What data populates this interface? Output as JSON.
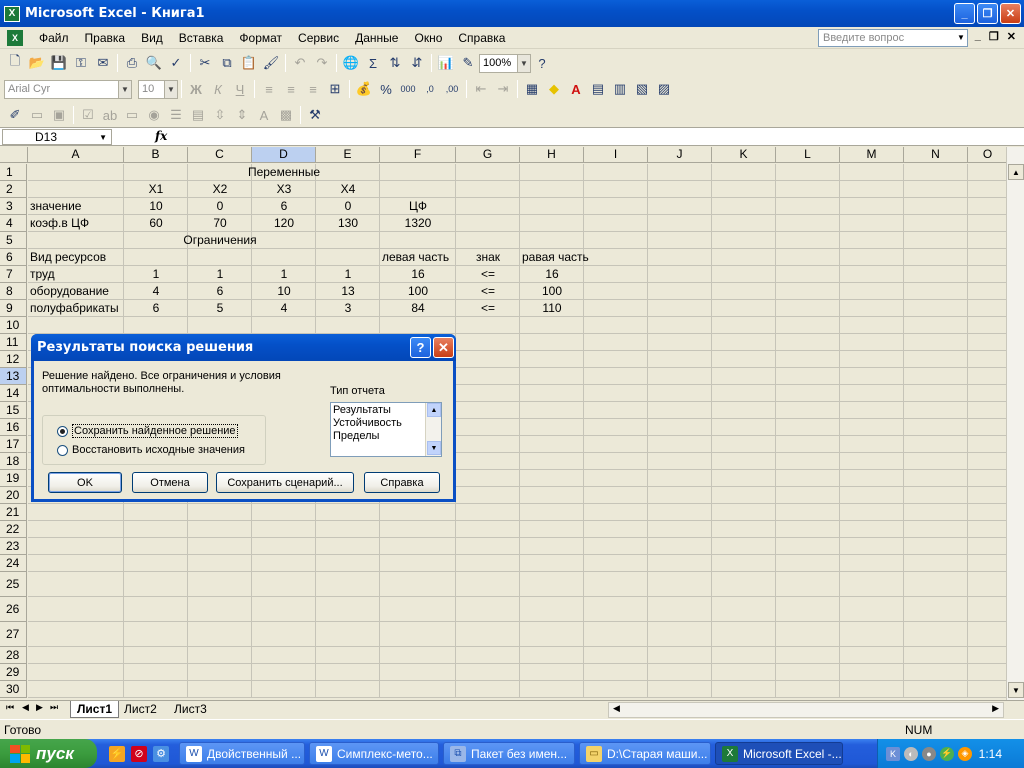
{
  "window": {
    "title": "Microsoft Excel - Книга1"
  },
  "menu": {
    "items": [
      "Файл",
      "Правка",
      "Вид",
      "Вставка",
      "Формат",
      "Сервис",
      "Данные",
      "Окно",
      "Справка"
    ],
    "ask_placeholder": "Введите вопрос"
  },
  "toolbar": {
    "zoom": "100%",
    "font_name": "Arial Cyr",
    "font_size": "10"
  },
  "formula": {
    "name_box": "D13",
    "fx": "fx",
    "content": ""
  },
  "grid": {
    "columns": [
      "A",
      "B",
      "C",
      "D",
      "E",
      "F",
      "G",
      "H",
      "I",
      "J",
      "K",
      "L",
      "M",
      "N",
      "O"
    ],
    "selected_column": "D",
    "rows": [
      "1",
      "2",
      "3",
      "4",
      "5",
      "6",
      "7",
      "8",
      "9",
      "10",
      "11",
      "12",
      "13",
      "14",
      "15",
      "16",
      "17",
      "18",
      "19",
      "20",
      "21",
      "22",
      "23",
      "24",
      "25",
      "26",
      "27",
      "28",
      "29",
      "30"
    ],
    "selected_row": "13",
    "r1": {
      "c": "Переменные"
    },
    "r2": {
      "b": "X1",
      "c": "X2",
      "d": "X3",
      "e": "X4"
    },
    "r3": {
      "a": "значение",
      "b": "10",
      "c": "0",
      "d": "6",
      "e": "0",
      "f": "ЦФ"
    },
    "r4": {
      "a": "коэф.в ЦФ",
      "b": "60",
      "c": "70",
      "d": "120",
      "e": "130",
      "f": "1320"
    },
    "r5": {
      "b": "Ограничения"
    },
    "r6": {
      "a": "Вид ресурсов",
      "f": "левая часть",
      "g": "знак",
      "h": "равая часть"
    },
    "r7": {
      "a": "труд",
      "b": "1",
      "c": "1",
      "d": "1",
      "e": "1",
      "f": "16",
      "g": "<=",
      "h": "16"
    },
    "r8": {
      "a": "оборудование",
      "b": "4",
      "c": "6",
      "d": "10",
      "e": "13",
      "f": "100",
      "g": "<=",
      "h": "100"
    },
    "r9": {
      "a": "полуфабрикаты",
      "b": "6",
      "c": "5",
      "d": "4",
      "e": "3",
      "f": "84",
      "g": "<=",
      "h": "110"
    }
  },
  "sheets": {
    "tabs": [
      "Лист1",
      "Лист2",
      "Лист3"
    ],
    "active": "Лист1"
  },
  "status": {
    "left": "Готово",
    "num": "NUM"
  },
  "dialog": {
    "title": "Результаты поиска решения",
    "message": "Решение найдено. Все ограничения и условия оптимальности выполнены.",
    "radio_keep": "Сохранить найденное решение",
    "radio_restore": "Восстановить исходные значения",
    "report_label": "Тип отчета",
    "report_items": [
      "Результаты",
      "Устойчивость",
      "Пределы"
    ],
    "btn_ok": "OK",
    "btn_cancel": "Отмена",
    "btn_save_scenario": "Сохранить сценарий...",
    "btn_help": "Справка"
  },
  "taskbar": {
    "start": "пуск",
    "tasks": [
      "Двойственный ...",
      "Симплекс-мето...",
      "Пакет без имен...",
      "D:\\Старая маши...",
      "Microsoft Excel -..."
    ],
    "clock": "1:14"
  }
}
